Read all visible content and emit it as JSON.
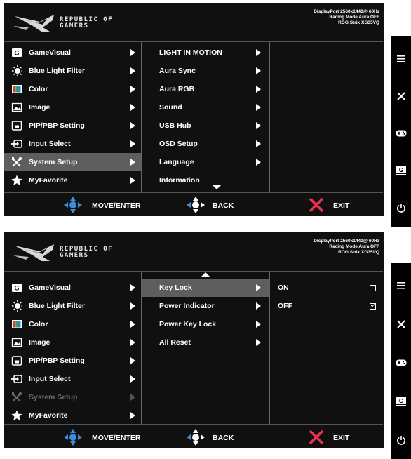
{
  "brand": {
    "line1": "REPUBLIC OF",
    "line2": "GAMERS"
  },
  "status": {
    "line1": "DisplayPort 2560x1440@ 60Hz",
    "line2": "Racing Mode Aura OFF",
    "line3": "ROG Strix XG35VQ"
  },
  "main_menu": [
    {
      "label": "GameVisual",
      "icon": "gamevisual-icon"
    },
    {
      "label": "Blue Light Filter",
      "icon": "blue-light-icon"
    },
    {
      "label": "Color",
      "icon": "color-icon"
    },
    {
      "label": "Image",
      "icon": "image-icon"
    },
    {
      "label": "PIP/PBP Setting",
      "icon": "pip-icon"
    },
    {
      "label": "Input Select",
      "icon": "input-icon"
    },
    {
      "label": "System Setup",
      "icon": "tools-icon"
    },
    {
      "label": "MyFavorite",
      "icon": "star-icon"
    }
  ],
  "screen1": {
    "selected_main": "System Setup",
    "submenu": [
      "LIGHT IN MOTION",
      "Aura Sync",
      "Aura RGB",
      "Sound",
      "USB Hub",
      "OSD Setup",
      "Language",
      "Information"
    ]
  },
  "screen2": {
    "dimmed_main": "System Setup",
    "submenu": [
      "Key Lock",
      "Power Indicator",
      "Power Key Lock",
      "All Reset"
    ],
    "selected_sub": "Key Lock",
    "options": [
      {
        "label": "ON",
        "checked": false
      },
      {
        "label": "OFF",
        "checked": true
      }
    ]
  },
  "footer": {
    "move_enter": "MOVE/ENTER",
    "back": "BACK",
    "exit": "EXIT"
  },
  "side_buttons": [
    "menu-icon",
    "close-icon",
    "gamepad-icon",
    "gamevisual-g-icon",
    "power-icon"
  ],
  "colors": {
    "background": "#101010",
    "selected": "#5e5e5e",
    "nav_blue": "#3a8fd8",
    "exit_red": "#e8344a"
  }
}
